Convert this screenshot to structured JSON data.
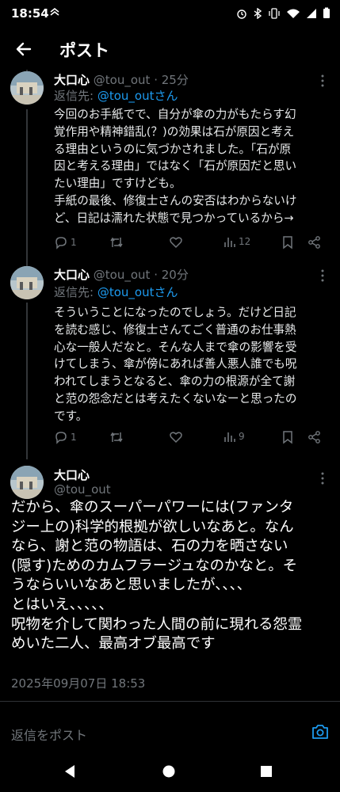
{
  "status_bar": {
    "time": "18:54",
    "icons": [
      "vpn-icon",
      "alarm-icon",
      "bluetooth-icon",
      "vibrate-icon",
      "wifi-icon",
      "signal-icon",
      "battery-icon"
    ]
  },
  "header": {
    "back_icon": "arrow-left-icon",
    "title": "ポスト"
  },
  "replies": [
    {
      "name": "大口心",
      "handle_time": "@tou_out · 25分",
      "replying_prefix": "返信先: ",
      "replying_to": "@tou_outさん",
      "text": "今回のお手紙でで、自分が傘の力がもたらす幻\n覚作用や精神錯乱(？)の効果は石が原因と考え\nる理由というのに気づかされました。「石が原\n因と考える理由」ではなく「石が原因だと思い\nたい理由」ですけども。\n手紙の最後、修復士さんの安否はわからないけ\nど、日記は濡れた状態で見つかっているから→",
      "actions": {
        "replies": "1",
        "reposts": "",
        "likes": "",
        "views": "12"
      }
    },
    {
      "name": "大口心",
      "handle_time": "@tou_out · 20分",
      "replying_prefix": "返信先: ",
      "replying_to": "@tou_outさん",
      "text": "そういうことになったのでしょう。だけど日記\nを読む感じ、修復士さんてごく普通のお仕事熱\n心な一般人だなと。そんな人まで傘の影響を受\nけてしまう、傘が傍にあれば善人悪人誰でも呪\nわれてしまうとなると、傘の力の根源が全て謝\nと范の怨念だとは考えたくないなーと思ったの\nです。",
      "actions": {
        "replies": "1",
        "reposts": "",
        "likes": "",
        "views": "9"
      }
    }
  ],
  "main_post": {
    "name": "大口心",
    "handle": "@tou_out",
    "text": "だから、傘のスーパーパワーには(ファンタ\nジー上の)科学的根拠が欲しいなあと。なん\nなら、謝と范の物語は、石の力を晒さない\n(隠す)ためのカムフラージュなのかなと。そ\nうならいいなあと思いましたが、、、、\nとはいえ、、、、、\n呪物を介して関わった人間の前に現れる怨霊\nめいた二人、最高オブ最高です",
    "timestamp": "2025年09月07日 18:53"
  },
  "reply_bar": {
    "placeholder": "返信をポスト",
    "camera_icon": "camera-icon"
  },
  "colors": {
    "background": "#000000",
    "text": "#e7e9ea",
    "muted": "#71767b",
    "accent": "#1d9bf0",
    "divider": "#2f3336"
  }
}
